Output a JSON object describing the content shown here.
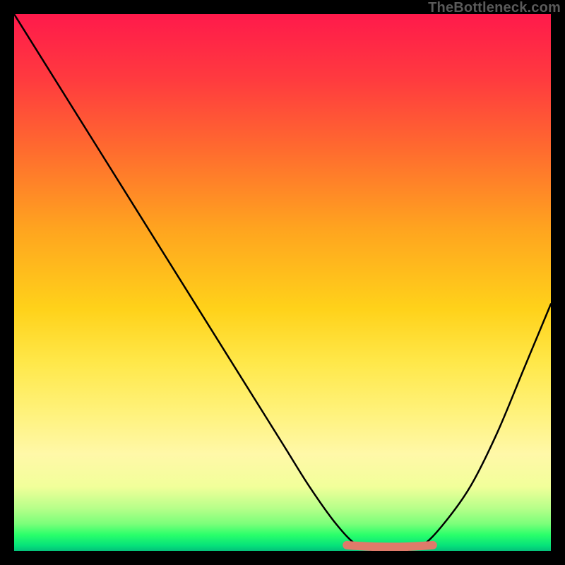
{
  "watermark": {
    "text": "TheBottleneck.com"
  },
  "chart_data": {
    "type": "line",
    "title": "",
    "xlabel": "",
    "ylabel": "",
    "xlim": [
      0,
      100
    ],
    "ylim": [
      0,
      100
    ],
    "grid": false,
    "legend": false,
    "series": [
      {
        "name": "black-curve",
        "color": "#000000",
        "x": [
          0,
          10,
          20,
          30,
          40,
          50,
          55,
          60,
          64,
          68,
          72,
          76,
          80,
          85,
          90,
          95,
          100
        ],
        "y": [
          100,
          84,
          68,
          52,
          36,
          20,
          12,
          5,
          1,
          0,
          0,
          1,
          5,
          12,
          22,
          34,
          46
        ]
      },
      {
        "name": "optimal-range",
        "color": "#e07a6a",
        "x": [
          62,
          78
        ],
        "y": [
          0.8,
          0.8
        ]
      }
    ],
    "annotations": [
      {
        "type": "gradient-background",
        "direction": "vertical",
        "top_color": "#ff1a4b",
        "bottom_color": "#04c27a"
      }
    ],
    "optimal_range": {
      "start": 62,
      "end": 78
    }
  }
}
